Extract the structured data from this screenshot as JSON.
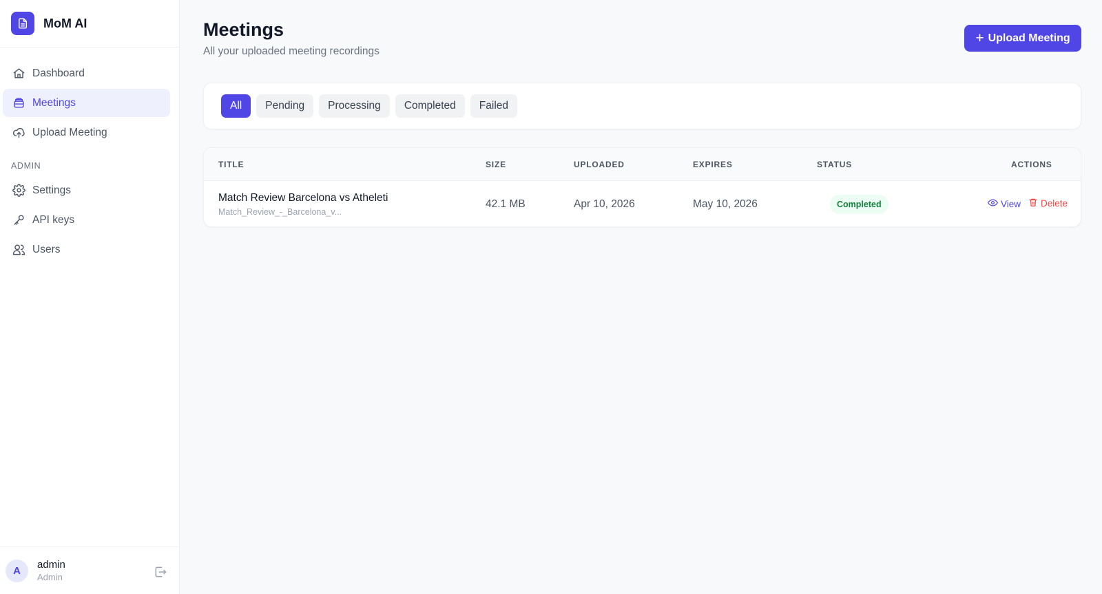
{
  "app": {
    "name": "MoM AI"
  },
  "sidebar": {
    "items": [
      {
        "label": "Dashboard",
        "icon": "home-icon"
      },
      {
        "label": "Meetings",
        "icon": "inbox-icon",
        "active": true
      },
      {
        "label": "Upload Meeting",
        "icon": "cloud-upload-icon"
      }
    ],
    "admin_section": "ADMIN",
    "admin_items": [
      {
        "label": "Settings",
        "icon": "gear-icon"
      },
      {
        "label": "API keys",
        "icon": "key-icon"
      },
      {
        "label": "Users",
        "icon": "users-icon"
      }
    ]
  },
  "user": {
    "initial": "A",
    "name": "admin",
    "role": "Admin"
  },
  "header": {
    "title": "Meetings",
    "subtitle": "All your uploaded meeting recordings",
    "upload_label": "Upload Meeting"
  },
  "filters": [
    "All",
    "Pending",
    "Processing",
    "Completed",
    "Failed"
  ],
  "active_filter": "All",
  "table": {
    "columns": [
      "TITLE",
      "SIZE",
      "UPLOADED",
      "EXPIRES",
      "STATUS",
      "ACTIONS"
    ],
    "rows": [
      {
        "title": "Match Review Barcelona vs Atheleti",
        "filename": "Match_Review_-_Barcelona_v...",
        "size": "42.1 MB",
        "uploaded": "Apr 10, 2026",
        "expires": "May 10, 2026",
        "status": "Completed",
        "view_label": "View",
        "delete_label": "Delete"
      }
    ]
  },
  "colors": {
    "accent": "#4f46e5",
    "success": "#15803d",
    "danger": "#ef4444"
  }
}
